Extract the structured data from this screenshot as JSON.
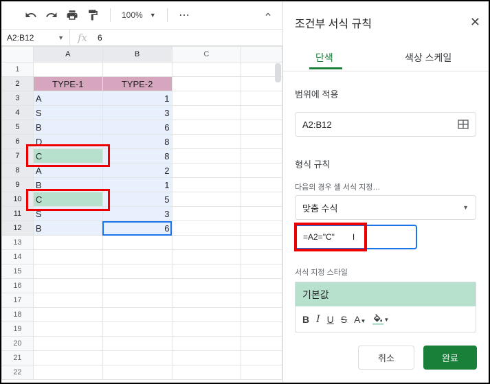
{
  "toolbar": {
    "zoom": "100%"
  },
  "formula_bar": {
    "name_box": "A2:B12",
    "fx": "fx",
    "value": "6"
  },
  "columns": [
    "A",
    "B",
    "C"
  ],
  "rows": [
    {
      "n": "1",
      "a": "",
      "b": ""
    },
    {
      "n": "2",
      "a": "TYPE-1",
      "b": "TYPE-2"
    },
    {
      "n": "3",
      "a": "A",
      "b": "1"
    },
    {
      "n": "4",
      "a": "S",
      "b": "3"
    },
    {
      "n": "5",
      "a": "B",
      "b": "6"
    },
    {
      "n": "6",
      "a": "D",
      "b": "8"
    },
    {
      "n": "7",
      "a": "C",
      "b": "8"
    },
    {
      "n": "8",
      "a": "A",
      "b": "2"
    },
    {
      "n": "9",
      "a": "B",
      "b": "1"
    },
    {
      "n": "10",
      "a": "C",
      "b": "5"
    },
    {
      "n": "11",
      "a": "S",
      "b": "3"
    },
    {
      "n": "12",
      "a": "B",
      "b": "6"
    },
    {
      "n": "13",
      "a": "",
      "b": ""
    },
    {
      "n": "14",
      "a": "",
      "b": ""
    },
    {
      "n": "15",
      "a": "",
      "b": ""
    },
    {
      "n": "16",
      "a": "",
      "b": ""
    },
    {
      "n": "17",
      "a": "",
      "b": ""
    },
    {
      "n": "18",
      "a": "",
      "b": ""
    },
    {
      "n": "19",
      "a": "",
      "b": ""
    },
    {
      "n": "20",
      "a": "",
      "b": ""
    },
    {
      "n": "21",
      "a": "",
      "b": ""
    },
    {
      "n": "22",
      "a": "",
      "b": ""
    }
  ],
  "panel": {
    "title": "조건부 서식 규칙",
    "tab_single": "단색",
    "tab_scale": "색상 스케일",
    "apply_range_label": "범위에 적용",
    "range_value": "A2:B12",
    "format_rules_label": "형식 규칙",
    "condition_label": "다음의 경우 셀 서식 지정…",
    "condition_value": "맞춤 수식",
    "formula_value": "=A2=\"C\"",
    "style_label": "서식 지정 스타일",
    "style_preview": "기본값",
    "fmt_bold": "B",
    "fmt_italic": "I",
    "fmt_underline": "U",
    "fmt_strike": "S",
    "fmt_color": "A",
    "cancel": "취소",
    "done": "완료"
  },
  "colors": {
    "header_fill": "#d5a6bd",
    "highlight_fill": "#b7e1cd",
    "selection_fill": "#e8f0fe",
    "accent_green": "#188038",
    "annotation_red": "#e00000"
  }
}
